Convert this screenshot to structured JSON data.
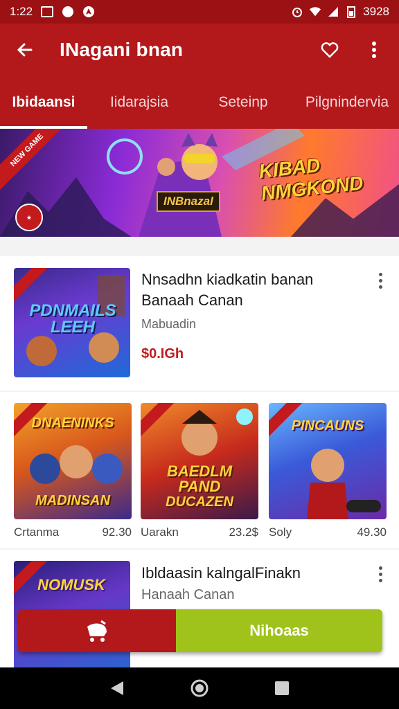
{
  "status_bar": {
    "time": "1:22",
    "battery_text": "3928"
  },
  "app_bar": {
    "title": "INagani bnan"
  },
  "tabs": [
    {
      "label": "Ibidaansi",
      "active": true
    },
    {
      "label": "Iidarajsia",
      "active": false
    },
    {
      "label": "Seteinp",
      "active": false
    },
    {
      "label": "Pilgnindervia",
      "active": false
    }
  ],
  "banner": {
    "ribbon_text": "NEW GAME",
    "hero_label": "INBnazal",
    "game_title": "KIBAD NMGKOND"
  },
  "featured": {
    "art_title": "PDNMAILS LEEH",
    "title": "Nnsadhn kiadkatin banan",
    "subtitle": "Banaah Canan",
    "developer": "Mabuadin",
    "price": "$0.IGh"
  },
  "grid_items": [
    {
      "art_top": "DNAENINKS",
      "art_bottom": "MADINSAN",
      "name": "Crtanma",
      "price": "92.30"
    },
    {
      "art_top": "BAEDLM PAND",
      "art_bottom": "DUCAZEN",
      "name": "Uarakn",
      "price": "23.2$"
    },
    {
      "art_top": "PINCAUNS",
      "art_bottom": "",
      "name": "Soly",
      "price": "49.30"
    }
  ],
  "second": {
    "art_title": "NOMUSK",
    "title": "Ibldaasin kalngalFinakn",
    "subtitle": "Hanaah Canan"
  },
  "action_bar": {
    "primary_label": "Nihoaas"
  },
  "colors": {
    "primary": "#b3181b",
    "accent": "#9fc31a",
    "status": "#9c1114"
  }
}
